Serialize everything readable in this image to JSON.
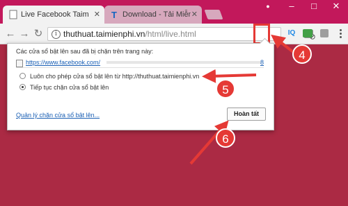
{
  "tabs": [
    {
      "title": "Live Facebook Taimienphi",
      "active": true
    },
    {
      "title": "Download - Tải Miễn Phí",
      "active": false
    }
  ],
  "window_controls": {
    "user": "●",
    "minimize": "–",
    "maximize": "□",
    "close": "✕"
  },
  "toolbar": {
    "url_host": "thuthuat.taimienphi.vn",
    "url_path": "/html/live.html",
    "extensions": [
      "IQ"
    ]
  },
  "popup": {
    "heading": "Các cửa sổ bật lên sau đã bị chặn trên trang này:",
    "blocked_link": "https://www.facebook.com/",
    "blocked_link_suffix": "8",
    "options": [
      {
        "label": "Luôn cho phép cửa sổ bật lên từ http://thuthuat.taimienphi.vn",
        "selected": false
      },
      {
        "label": "Tiếp tục chặn cửa sổ bật lên",
        "selected": true
      }
    ],
    "manage_link": "Quản lý chặn cửa sổ bật lên...",
    "done_button": "Hoàn tất"
  },
  "steps": [
    "4",
    "5",
    "6"
  ],
  "colors": {
    "accent": "#c2185b",
    "annotation": "#e53935",
    "link": "#1a5fb4"
  }
}
